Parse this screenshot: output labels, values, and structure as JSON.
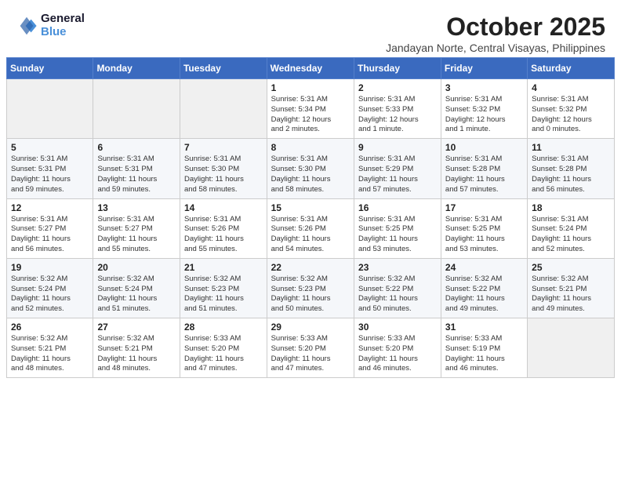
{
  "header": {
    "logo_line1": "General",
    "logo_line2": "Blue",
    "month": "October 2025",
    "location": "Jandayan Norte, Central Visayas, Philippines"
  },
  "weekdays": [
    "Sunday",
    "Monday",
    "Tuesday",
    "Wednesday",
    "Thursday",
    "Friday",
    "Saturday"
  ],
  "weeks": [
    [
      {
        "day": "",
        "info": ""
      },
      {
        "day": "",
        "info": ""
      },
      {
        "day": "",
        "info": ""
      },
      {
        "day": "1",
        "info": "Sunrise: 5:31 AM\nSunset: 5:34 PM\nDaylight: 12 hours\nand 2 minutes."
      },
      {
        "day": "2",
        "info": "Sunrise: 5:31 AM\nSunset: 5:33 PM\nDaylight: 12 hours\nand 1 minute."
      },
      {
        "day": "3",
        "info": "Sunrise: 5:31 AM\nSunset: 5:32 PM\nDaylight: 12 hours\nand 1 minute."
      },
      {
        "day": "4",
        "info": "Sunrise: 5:31 AM\nSunset: 5:32 PM\nDaylight: 12 hours\nand 0 minutes."
      }
    ],
    [
      {
        "day": "5",
        "info": "Sunrise: 5:31 AM\nSunset: 5:31 PM\nDaylight: 11 hours\nand 59 minutes."
      },
      {
        "day": "6",
        "info": "Sunrise: 5:31 AM\nSunset: 5:31 PM\nDaylight: 11 hours\nand 59 minutes."
      },
      {
        "day": "7",
        "info": "Sunrise: 5:31 AM\nSunset: 5:30 PM\nDaylight: 11 hours\nand 58 minutes."
      },
      {
        "day": "8",
        "info": "Sunrise: 5:31 AM\nSunset: 5:30 PM\nDaylight: 11 hours\nand 58 minutes."
      },
      {
        "day": "9",
        "info": "Sunrise: 5:31 AM\nSunset: 5:29 PM\nDaylight: 11 hours\nand 57 minutes."
      },
      {
        "day": "10",
        "info": "Sunrise: 5:31 AM\nSunset: 5:28 PM\nDaylight: 11 hours\nand 57 minutes."
      },
      {
        "day": "11",
        "info": "Sunrise: 5:31 AM\nSunset: 5:28 PM\nDaylight: 11 hours\nand 56 minutes."
      }
    ],
    [
      {
        "day": "12",
        "info": "Sunrise: 5:31 AM\nSunset: 5:27 PM\nDaylight: 11 hours\nand 56 minutes."
      },
      {
        "day": "13",
        "info": "Sunrise: 5:31 AM\nSunset: 5:27 PM\nDaylight: 11 hours\nand 55 minutes."
      },
      {
        "day": "14",
        "info": "Sunrise: 5:31 AM\nSunset: 5:26 PM\nDaylight: 11 hours\nand 55 minutes."
      },
      {
        "day": "15",
        "info": "Sunrise: 5:31 AM\nSunset: 5:26 PM\nDaylight: 11 hours\nand 54 minutes."
      },
      {
        "day": "16",
        "info": "Sunrise: 5:31 AM\nSunset: 5:25 PM\nDaylight: 11 hours\nand 53 minutes."
      },
      {
        "day": "17",
        "info": "Sunrise: 5:31 AM\nSunset: 5:25 PM\nDaylight: 11 hours\nand 53 minutes."
      },
      {
        "day": "18",
        "info": "Sunrise: 5:31 AM\nSunset: 5:24 PM\nDaylight: 11 hours\nand 52 minutes."
      }
    ],
    [
      {
        "day": "19",
        "info": "Sunrise: 5:32 AM\nSunset: 5:24 PM\nDaylight: 11 hours\nand 52 minutes."
      },
      {
        "day": "20",
        "info": "Sunrise: 5:32 AM\nSunset: 5:24 PM\nDaylight: 11 hours\nand 51 minutes."
      },
      {
        "day": "21",
        "info": "Sunrise: 5:32 AM\nSunset: 5:23 PM\nDaylight: 11 hours\nand 51 minutes."
      },
      {
        "day": "22",
        "info": "Sunrise: 5:32 AM\nSunset: 5:23 PM\nDaylight: 11 hours\nand 50 minutes."
      },
      {
        "day": "23",
        "info": "Sunrise: 5:32 AM\nSunset: 5:22 PM\nDaylight: 11 hours\nand 50 minutes."
      },
      {
        "day": "24",
        "info": "Sunrise: 5:32 AM\nSunset: 5:22 PM\nDaylight: 11 hours\nand 49 minutes."
      },
      {
        "day": "25",
        "info": "Sunrise: 5:32 AM\nSunset: 5:21 PM\nDaylight: 11 hours\nand 49 minutes."
      }
    ],
    [
      {
        "day": "26",
        "info": "Sunrise: 5:32 AM\nSunset: 5:21 PM\nDaylight: 11 hours\nand 48 minutes."
      },
      {
        "day": "27",
        "info": "Sunrise: 5:32 AM\nSunset: 5:21 PM\nDaylight: 11 hours\nand 48 minutes."
      },
      {
        "day": "28",
        "info": "Sunrise: 5:33 AM\nSunset: 5:20 PM\nDaylight: 11 hours\nand 47 minutes."
      },
      {
        "day": "29",
        "info": "Sunrise: 5:33 AM\nSunset: 5:20 PM\nDaylight: 11 hours\nand 47 minutes."
      },
      {
        "day": "30",
        "info": "Sunrise: 5:33 AM\nSunset: 5:20 PM\nDaylight: 11 hours\nand 46 minutes."
      },
      {
        "day": "31",
        "info": "Sunrise: 5:33 AM\nSunset: 5:19 PM\nDaylight: 11 hours\nand 46 minutes."
      },
      {
        "day": "",
        "info": ""
      }
    ]
  ]
}
